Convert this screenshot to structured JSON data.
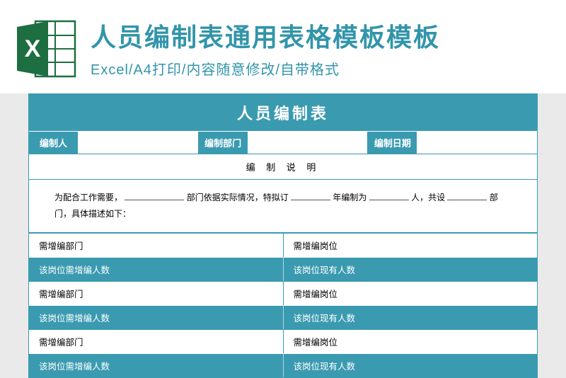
{
  "header": {
    "title": "人员编制表通用表格模板模板",
    "subtitle": "Excel/A4打印/内容随意修改/自带格式",
    "icon_letter": "X"
  },
  "sheet": {
    "title": "人员编制表",
    "meta": {
      "person_label": "编制人",
      "person_value": "",
      "dept_label": "编制部门",
      "dept_value": "",
      "date_label": "编制日期",
      "date_value": ""
    },
    "section_heading": "编 制 说 明",
    "desc": {
      "p1_a": "为配合工作需要，",
      "p1_b": "部门依据实际情况，特拟订",
      "p1_c": "年编制为",
      "p1_d": "人，共设",
      "p1_e": "部",
      "p2": "门，具体描述如下："
    },
    "rows": [
      {
        "style": "white",
        "left": "需增编部门",
        "right": "需增编岗位"
      },
      {
        "style": "teal",
        "left": "该岗位需增编人数",
        "right": "该岗位现有人数"
      },
      {
        "style": "white",
        "left": "需增编部门",
        "right": "需增编岗位"
      },
      {
        "style": "teal",
        "left": "该岗位需增编人数",
        "right": "该岗位现有人数"
      },
      {
        "style": "white",
        "left": "需增编部门",
        "right": "需增编岗位"
      },
      {
        "style": "teal",
        "left": "该岗位需增编人数",
        "right": "该岗位现有人数"
      }
    ]
  }
}
